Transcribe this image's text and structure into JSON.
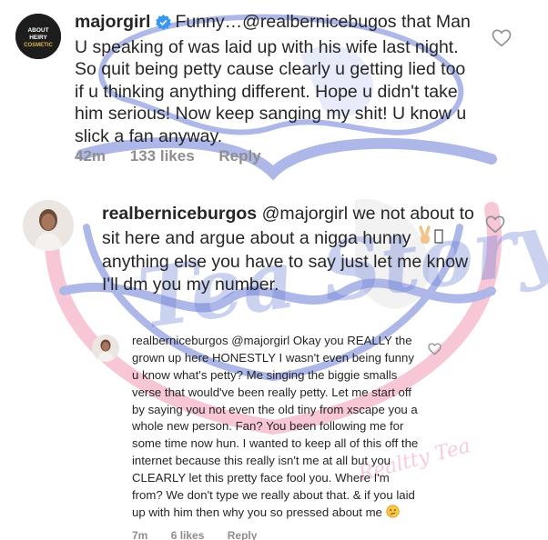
{
  "comments": [
    {
      "username": "majorgirl",
      "verified": true,
      "text": "Funny…@realbernicebugos that Man U speaking of was laid up with his wife last night. So quit being petty cause clearly u getting lied too if u thinking anything different. Hope u didn't take him serious! Now keep sanging my shit! U know u slick a fan anyway.",
      "time": "42m",
      "likes": "133 likes",
      "reply_label": "Reply",
      "avatar_text": "ABOUT HEIRY COSMETICS"
    },
    {
      "username": "realberniceburgos",
      "text_before": "@majorgirl we not about to sit here and argue about a nigga hunny ",
      "text_after": "anything else you have to say just let me know I'll dm you my number."
    },
    {
      "username": "realberniceburgos",
      "text": "@majorgirl Okay you REALLY the grown up here HONESTLY I wasn't even being funny u know what's petty? Me singing the biggie smalls verse that would've been really petty. Let me start off by saying you not even the old tiny from xscape you a whole new person. Fan? You been following me for some time now hun. I wanted to keep all of this off the internet because this really isn't me at all but you CLEARLY let this pretty face fool you. Where I'm from? We don't type we really about that. & if you laid up with him then why you so pressed about me",
      "time": "7m",
      "likes": "6 likes",
      "reply_label": "Reply"
    }
  ],
  "icons": {
    "verified": "verified-badge-icon",
    "like": "heart-outline-icon",
    "victory": "victory-hand-emoji",
    "thinking": "thinking-face-emoji"
  },
  "colors": {
    "text": "#262626",
    "meta": "#8e8e8e",
    "verified": "#3897f0",
    "watermark_blue": "#6b7fd6",
    "watermark_pink": "#f29ab6"
  },
  "watermark": {
    "script_text": "Tea Story",
    "small_text": "Realtty Tea"
  }
}
